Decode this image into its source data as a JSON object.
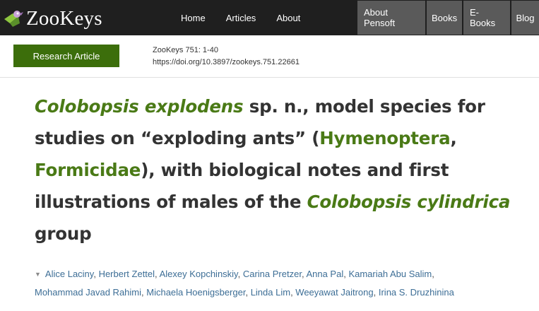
{
  "brand": {
    "name": "ZooKeys"
  },
  "nav": {
    "main": [
      "Home",
      "Articles",
      "About"
    ],
    "right": [
      "About Pensoft",
      "Books",
      "E-Books",
      "Blog"
    ]
  },
  "article": {
    "type_label": "Research Article",
    "citation": "ZooKeys 751: 1-40",
    "doi": "https://doi.org/10.3897/zookeys.751.22661"
  },
  "title": {
    "genus_species": "Colobopsis explodens",
    "part1": " sp. n., model species for studies on “exploding ants” (",
    "order": "Hymenoptera",
    "comma": ", ",
    "family": "Formicidae",
    "part2": "), with biological notes and first illustrations of males of the ",
    "group_taxon": "Colobopsis cylindrica",
    "part3": " group"
  },
  "authors": [
    "Alice Laciny",
    "Herbert Zettel",
    "Alexey Kopchinskiy",
    "Carina Pretzer",
    "Anna Pal",
    "Kamariah Abu Salim",
    "Mohammad Javad Rahimi",
    "Michaela Hoenigsberger",
    "Linda Lim",
    "Weeyawat Jaitrong",
    "Irina S. Druzhinina"
  ],
  "colors": {
    "topbar": "#1f1f1f",
    "nav_box": "#5a5a5a",
    "accent_green": "#3c6e0b",
    "taxon_green": "#4a7a16",
    "author_link": "#3d6e96"
  }
}
